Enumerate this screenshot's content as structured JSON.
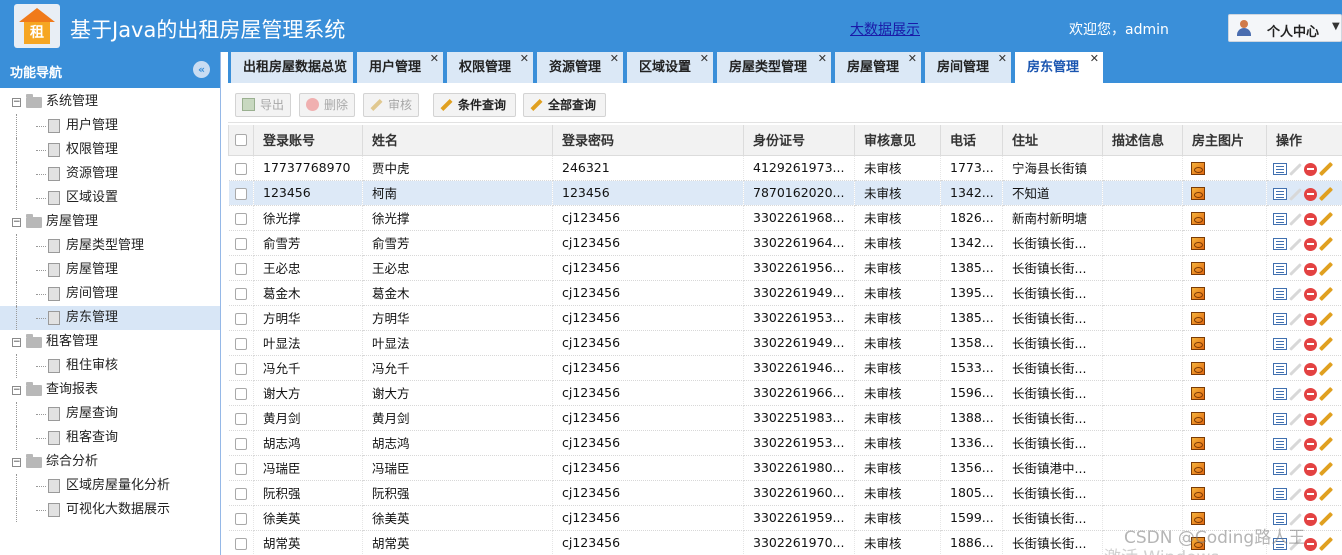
{
  "header": {
    "title": "基于Java的出租房屋管理系统",
    "logo_char": "租",
    "bigdata_link": "大数据展示",
    "welcome": "欢迎您，admin",
    "personal_center": "个人中心"
  },
  "sidebar": {
    "title": "功能导航",
    "tree": [
      {
        "label": "系统管理",
        "children": [
          "用户管理",
          "权限管理",
          "资源管理",
          "区域设置"
        ]
      },
      {
        "label": "房屋管理",
        "children": [
          "房屋类型管理",
          "房屋管理",
          "房间管理",
          "房东管理"
        ]
      },
      {
        "label": "租客管理",
        "children": [
          "租住审核"
        ]
      },
      {
        "label": "查询报表",
        "children": [
          "房屋查询",
          "租客查询"
        ]
      },
      {
        "label": "综合分析",
        "children": [
          "区域房屋量化分析",
          "可视化大数据展示"
        ]
      }
    ],
    "selected": "房东管理"
  },
  "tabs": [
    {
      "label": "出租房屋数据总览",
      "closable": false
    },
    {
      "label": "用户管理",
      "closable": true
    },
    {
      "label": "权限管理",
      "closable": true
    },
    {
      "label": "资源管理",
      "closable": true
    },
    {
      "label": "区域设置",
      "closable": true
    },
    {
      "label": "房屋类型管理",
      "closable": true
    },
    {
      "label": "房屋管理",
      "closable": true
    },
    {
      "label": "房间管理",
      "closable": true
    },
    {
      "label": "房东管理",
      "closable": true,
      "active": true
    }
  ],
  "toolbar": {
    "export": "导出",
    "delete": "删除",
    "audit": "审核",
    "query": "条件查询",
    "query_all": "全部查询"
  },
  "table": {
    "columns": [
      "登录账号",
      "姓名",
      "登录密码",
      "身份证号",
      "审核意见",
      "电话",
      "住址",
      "描述信息",
      "房主图片",
      "操作"
    ],
    "rows": [
      [
        "17737768970",
        "贾中虎",
        "246321",
        "4129261973...",
        "未审核",
        "1773...",
        "宁海县长街镇",
        ""
      ],
      [
        "123456",
        "柯南",
        "123456",
        "7870162020...",
        "未审核",
        "1342...",
        "不知道",
        ""
      ],
      [
        "徐光撑",
        "徐光撑",
        "cj123456",
        "3302261968...",
        "未审核",
        "1826...",
        "新南村新明塘",
        ""
      ],
      [
        "俞雪芳",
        "俞雪芳",
        "cj123456",
        "3302261964...",
        "未审核",
        "1342...",
        "长街镇长街...",
        ""
      ],
      [
        "王必忠",
        "王必忠",
        "cj123456",
        "3302261956...",
        "未审核",
        "1385...",
        "长街镇长街...",
        ""
      ],
      [
        "葛金木",
        "葛金木",
        "cj123456",
        "3302261949...",
        "未审核",
        "1395...",
        "长街镇长街...",
        ""
      ],
      [
        "方明华",
        "方明华",
        "cj123456",
        "3302261953...",
        "未审核",
        "1385...",
        "长街镇长街...",
        ""
      ],
      [
        "叶显法",
        "叶显法",
        "cj123456",
        "3302261949...",
        "未审核",
        "1358...",
        "长街镇长街...",
        ""
      ],
      [
        "冯允千",
        "冯允千",
        "cj123456",
        "3302261946...",
        "未审核",
        "1533...",
        "长街镇长街...",
        ""
      ],
      [
        "谢大方",
        "谢大方",
        "cj123456",
        "3302261966...",
        "未审核",
        "1596...",
        "长街镇长街...",
        ""
      ],
      [
        "黄月剑",
        "黄月剑",
        "cj123456",
        "3302251983...",
        "未审核",
        "1388...",
        "长街镇长街...",
        ""
      ],
      [
        "胡志鸿",
        "胡志鸿",
        "cj123456",
        "3302261953...",
        "未审核",
        "1336...",
        "长街镇长街...",
        ""
      ],
      [
        "冯瑞臣",
        "冯瑞臣",
        "cj123456",
        "3302261980...",
        "未审核",
        "1356...",
        "长街镇港中...",
        ""
      ],
      [
        "阮积强",
        "阮积强",
        "cj123456",
        "3302261960...",
        "未审核",
        "1805...",
        "长街镇长街...",
        ""
      ],
      [
        "徐美英",
        "徐美英",
        "cj123456",
        "3302261959...",
        "未审核",
        "1599...",
        "长街镇长街...",
        ""
      ],
      [
        "胡常英",
        "胡常英",
        "cj123456",
        "3302261970...",
        "未审核",
        "1886...",
        "长街镇长街...",
        ""
      ]
    ],
    "selected_row": 1
  },
  "watermark": "CSDN @Coding路人王",
  "watermark2": "激活 Windows",
  "colors": {
    "brand": "#3a8fd9",
    "tab_bg": "#dbe8f6",
    "selected": "#dde9f7"
  }
}
